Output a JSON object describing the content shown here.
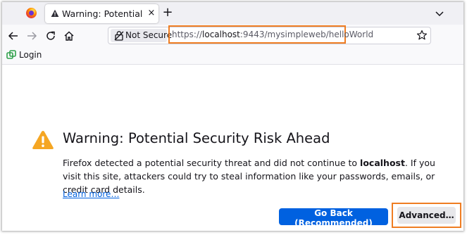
{
  "colors": {
    "accent": "#0061e0",
    "highlight": "#ef7d22",
    "warning": "#f5a623"
  },
  "tabs": [
    {
      "title": "Warning: Potential Security Risk Ahead",
      "icon": "warning-icon",
      "close_glyph": "×"
    }
  ],
  "tabstrip": {
    "new_tab_glyph": "+",
    "browser_icon": "firefox-icon",
    "list_tabs_icon": "chevron-down-icon"
  },
  "navbar": {
    "back_icon": "back-arrow-icon",
    "forward_icon": "forward-arrow-icon",
    "reload_icon": "reload-icon",
    "home_icon": "home-icon",
    "security_label": "Not Secure",
    "url": {
      "scheme": "https://",
      "host": "localhost",
      "rest": ":9443/mysimpleweb/helloWorld"
    },
    "bookmark_icon": "star-icon"
  },
  "bookmarks": [
    {
      "label": "Login",
      "icon": "bookmark-favicon-icon"
    }
  ],
  "error_page": {
    "heading": "Warning: Potential Security Risk Ahead",
    "description_pre": "Firefox detected a potential security threat and did not continue to ",
    "description_host": "localhost",
    "description_post": ". If you visit this site, attackers could try to steal information like your passwords, emails, or credit card details.",
    "learn_more": "Learn more…",
    "go_back_label": "Go Back (Recommended)",
    "advanced_label": "Advanced…"
  }
}
